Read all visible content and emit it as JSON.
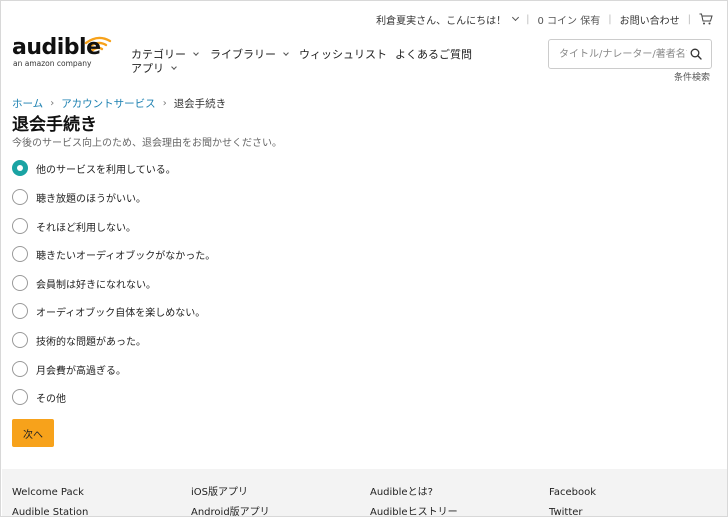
{
  "header": {
    "greeting": "利倉夏実さん、こんにちは！",
    "coins": "0 コイン 保有",
    "contact": "お問い合わせ"
  },
  "logo": {
    "word": "audible",
    "sub": "an amazon company"
  },
  "nav": {
    "categories": "カテゴリー",
    "library": "ライブラリー",
    "wishlist": "ウィッシュリスト",
    "faq": "よくあるご質問",
    "apps": "アプリ"
  },
  "search": {
    "placeholder": "タイトル/ナレーター/著者名で",
    "advanced": "条件検索"
  },
  "breadcrumb": {
    "home": "ホーム",
    "account": "アカウントサービス",
    "current": "退会手続き"
  },
  "page": {
    "title": "退会手続き",
    "subtitle": "今後のサービス向上のため、退会理由をお聞かせください。"
  },
  "reasons": [
    {
      "label": "他のサービスを利用している。",
      "checked": true
    },
    {
      "label": "聴き放題のほうがいい。",
      "checked": false
    },
    {
      "label": "それほど利用しない。",
      "checked": false
    },
    {
      "label": "聴きたいオーディオブックがなかった。",
      "checked": false
    },
    {
      "label": "会員制は好きになれない。",
      "checked": false
    },
    {
      "label": "オーディオブック自体を楽しめない。",
      "checked": false
    },
    {
      "label": "技術的な問題があった。",
      "checked": false
    },
    {
      "label": "月会費が高過ぎる。",
      "checked": false
    },
    {
      "label": "その他",
      "checked": false
    }
  ],
  "next_label": "次へ",
  "footer": {
    "col1": [
      "Welcome Pack",
      "Audible Station"
    ],
    "col2": [
      "iOS版アプリ",
      "Android版アプリ"
    ],
    "col3": [
      "Audibleとは?",
      "Audibleヒストリー"
    ],
    "col4": [
      "Facebook",
      "Twitter"
    ]
  },
  "colors": {
    "accent_teal": "#1aa3a3",
    "button_orange": "#f7a21b",
    "logo_orange": "#f7a21b",
    "link_blue": "#1a7fb0"
  }
}
